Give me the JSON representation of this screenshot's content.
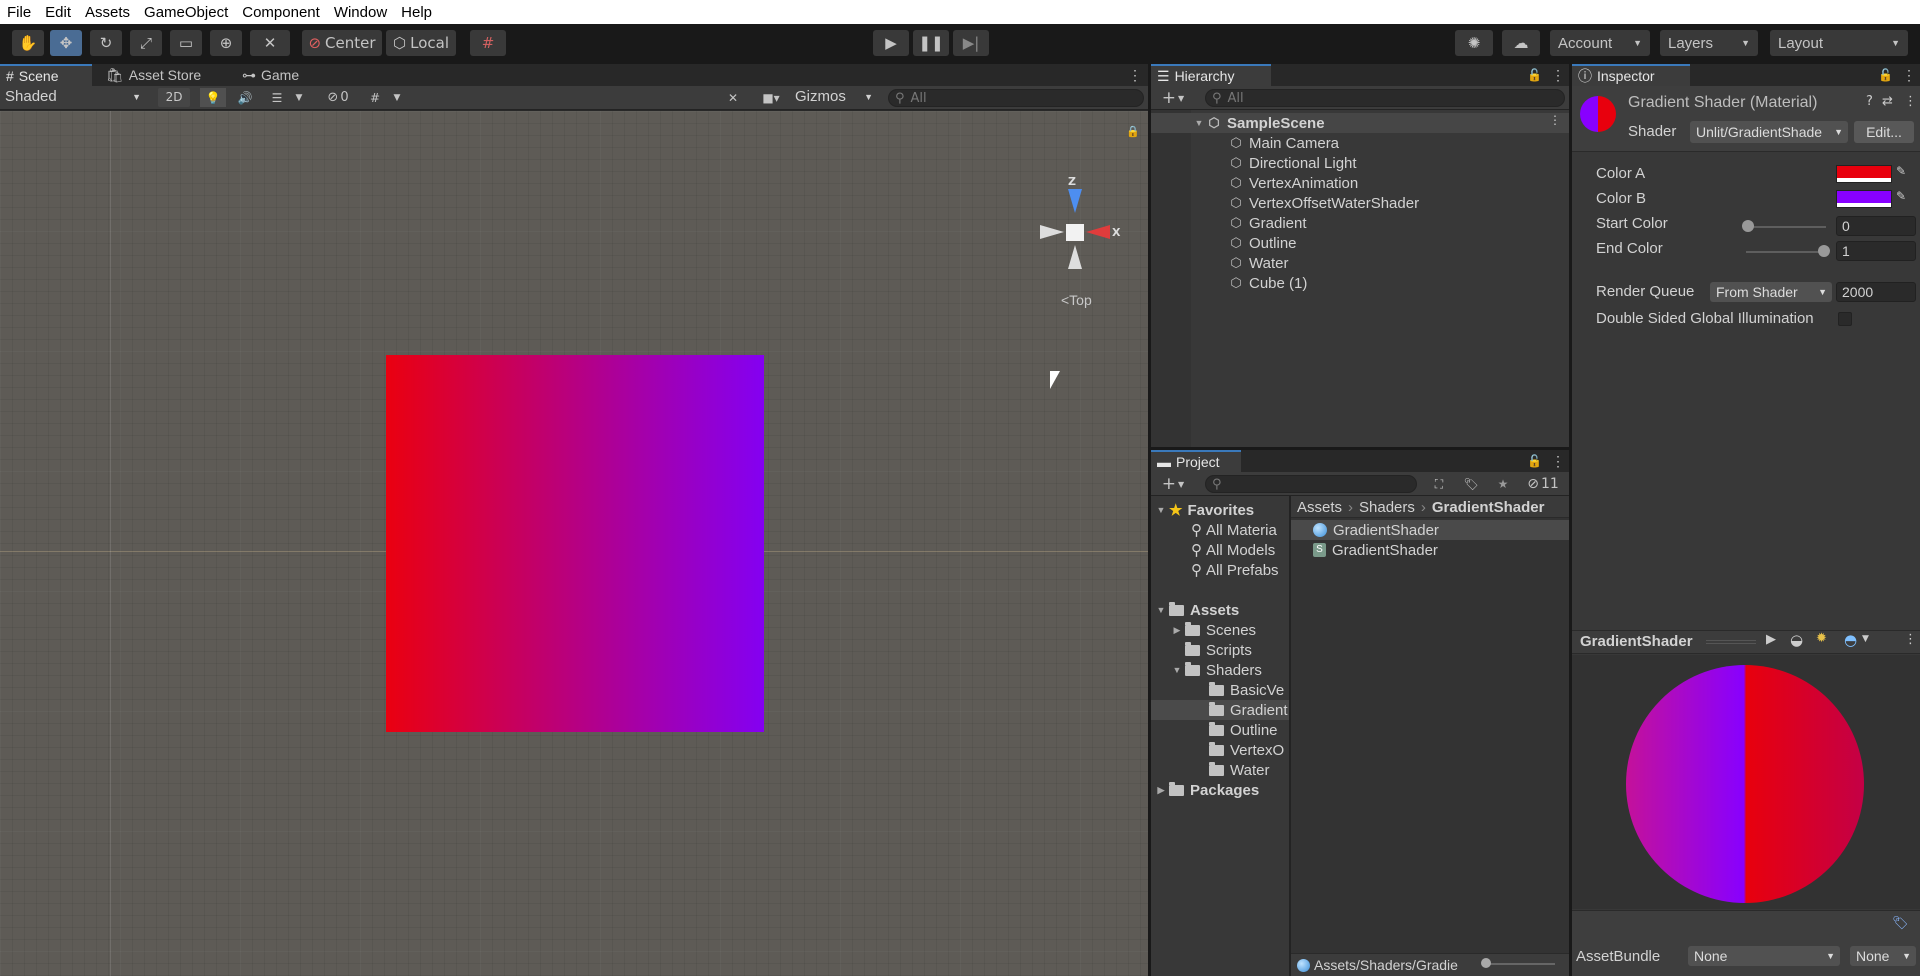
{
  "menu": [
    "File",
    "Edit",
    "Assets",
    "GameObject",
    "Component",
    "Window",
    "Help"
  ],
  "toolbar": {
    "center": "Center",
    "local": "Local",
    "account": "Account",
    "layers": "Layers",
    "layout": "Layout"
  },
  "scene_panel": {
    "tabs": [
      "Scene",
      "Asset Store",
      "Game"
    ],
    "shading_mode": "Shaded",
    "mode_2d": "2D",
    "hidden_count": "0",
    "gizmos": "Gizmos",
    "search_placeholder": "All",
    "view_label": "<Top",
    "axis_y": "Z",
    "axis_x": "X",
    "quad_gradient": {
      "from": "#ea0010",
      "to": "#8400f2"
    }
  },
  "hierarchy": {
    "title": "Hierarchy",
    "search_placeholder": "All",
    "scene": "SampleScene",
    "objects": [
      "Main Camera",
      "Directional Light",
      "VertexAnimation",
      "VertexOffsetWaterShader",
      "Gradient",
      "Outline",
      "Water",
      "Cube (1)"
    ]
  },
  "project": {
    "title": "Project",
    "hidden_count": "11",
    "favorites_label": "Favorites",
    "favorites": [
      "All Materia",
      "All Models",
      "All Prefabs"
    ],
    "assets_label": "Assets",
    "folders": [
      "Scenes",
      "Scripts",
      "Shaders"
    ],
    "shader_folders": [
      "BasicVe",
      "Gradient",
      "Outline",
      "VertexO",
      "Water"
    ],
    "packages_label": "Packages",
    "breadcrumb": [
      "Assets",
      "Shaders",
      "GradientShader"
    ],
    "files": [
      "GradientShader",
      "GradientShader"
    ],
    "footer_path": "Assets/Shaders/Gradie"
  },
  "inspector": {
    "title": "Inspector",
    "material_name": "Gradient Shader (Material)",
    "shader_label": "Shader",
    "shader_value": "Unlit/GradientShadе",
    "edit_button": "Edit...",
    "props": {
      "color_a_label": "Color A",
      "color_a": "#e8000d",
      "color_b_label": "Color B",
      "color_b": "#8800ff",
      "start_color_label": "Start Color",
      "start_color_value": "0",
      "end_color_label": "End Color",
      "end_color_value": "1",
      "render_queue_label": "Render Queue",
      "render_queue_mode": "From Shader",
      "render_queue_value": "2000",
      "double_sided_label": "Double Sided Global Illumination"
    },
    "preview_title": "GradientShader",
    "asset_bundle_label": "AssetBundle",
    "asset_bundle_value": "None",
    "asset_bundle_variant": "None"
  }
}
